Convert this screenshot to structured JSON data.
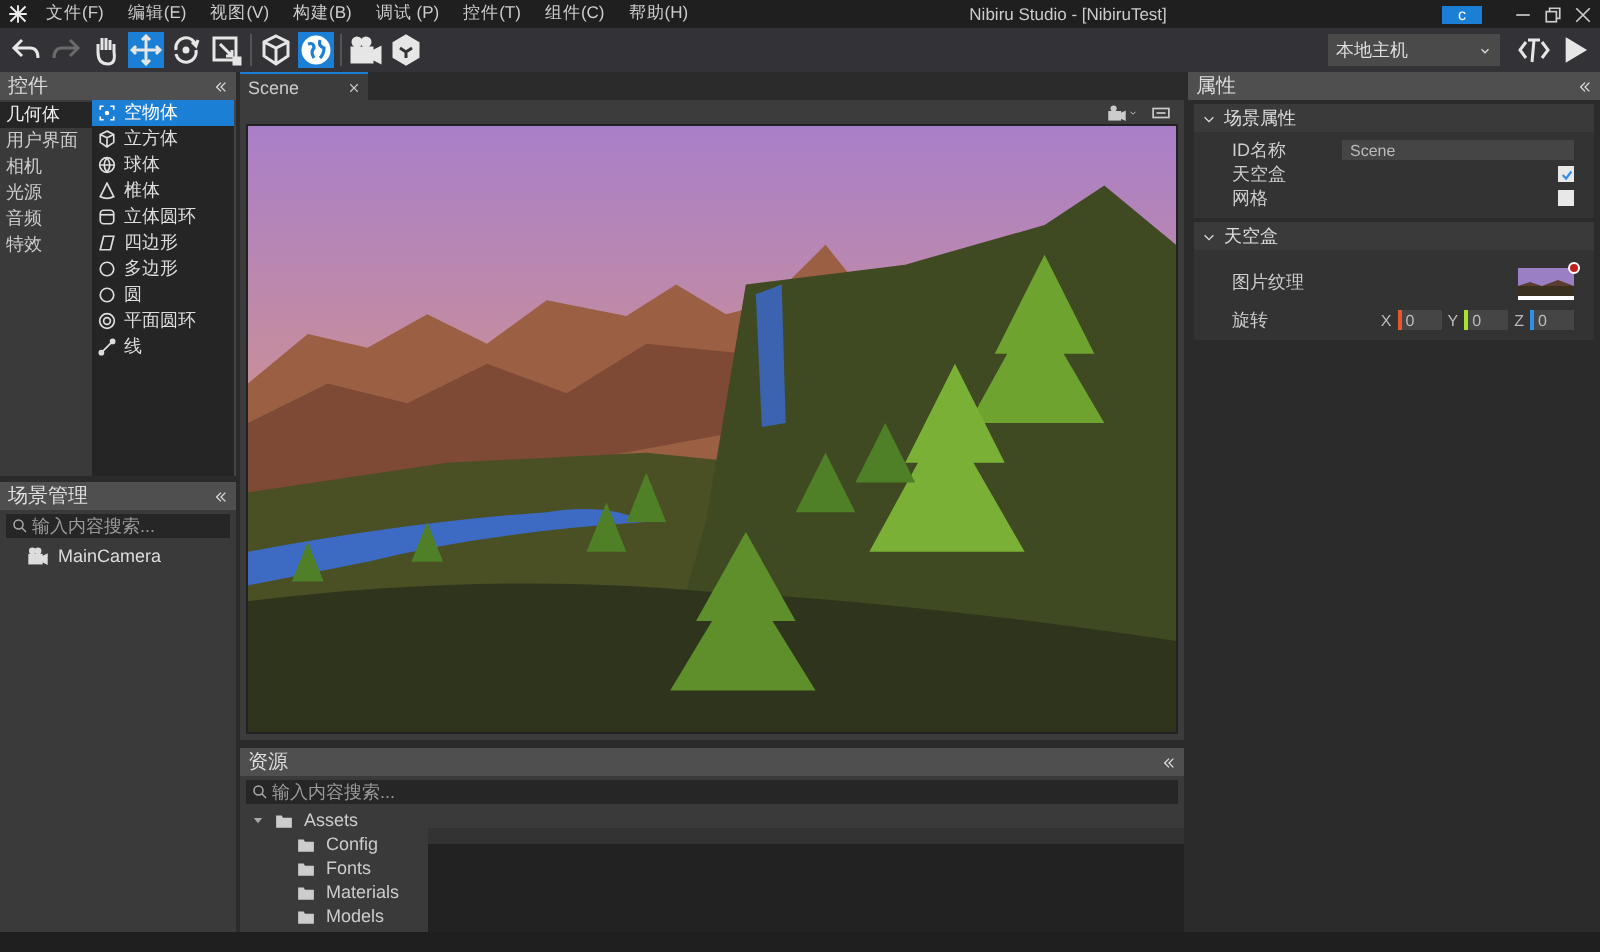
{
  "window": {
    "title": "Nibiru Studio - [NibiruTest]",
    "account_button": "c"
  },
  "menu": [
    "文件(F)",
    "编辑(E)",
    "视图(V)",
    "构建(B)",
    "调试 (P)",
    "控件(T)",
    "组件(C)",
    "帮助(H)"
  ],
  "toolbar": {
    "tools": [
      {
        "kind": "undo",
        "selected": false,
        "disabled": false
      },
      {
        "kind": "redo",
        "selected": false,
        "disabled": true
      },
      {
        "kind": "hand",
        "selected": false,
        "disabled": false
      },
      {
        "kind": "move",
        "selected": true,
        "disabled": false
      },
      {
        "kind": "rotate",
        "selected": false,
        "disabled": false
      },
      {
        "kind": "scale",
        "selected": false,
        "disabled": false
      },
      {
        "kind": "cube",
        "selected": false,
        "disabled": false
      },
      {
        "kind": "globe",
        "selected": true,
        "disabled": false
      },
      {
        "kind": "camera",
        "selected": false,
        "disabled": false
      },
      {
        "kind": "box",
        "selected": false,
        "disabled": false
      }
    ],
    "host_select": "本地主机"
  },
  "controls_panel": {
    "title": "控件",
    "categories": [
      {
        "label": "几何体",
        "selected": true
      },
      {
        "label": "用户界面",
        "selected": false
      },
      {
        "label": "相机",
        "selected": false
      },
      {
        "label": "光源",
        "selected": false
      },
      {
        "label": "音频",
        "selected": false
      },
      {
        "label": "特效",
        "selected": false
      }
    ],
    "items": [
      {
        "label": "空物体",
        "kind": "empty",
        "selected": true
      },
      {
        "label": "立方体",
        "kind": "cube",
        "selected": false
      },
      {
        "label": "球体",
        "kind": "sphere",
        "selected": false
      },
      {
        "label": "椎体",
        "kind": "cone",
        "selected": false
      },
      {
        "label": "立体圆环",
        "kind": "cylinder",
        "selected": false
      },
      {
        "label": "四边形",
        "kind": "quad",
        "selected": false
      },
      {
        "label": "多边形",
        "kind": "polygon",
        "selected": false
      },
      {
        "label": "圆",
        "kind": "circle",
        "selected": false
      },
      {
        "label": "平面圆环",
        "kind": "ring",
        "selected": false
      },
      {
        "label": "线",
        "kind": "line",
        "selected": false
      }
    ]
  },
  "scene_manager": {
    "title": "场景管理",
    "search_placeholder": "输入内容搜索...",
    "items": [
      {
        "label": "MainCamera",
        "kind": "camera"
      }
    ]
  },
  "scene_tab": {
    "label": "Scene"
  },
  "assets": {
    "title": "资源",
    "search_placeholder": "输入内容搜索...",
    "tree": [
      {
        "label": "Assets",
        "expanded": true,
        "children": [
          {
            "label": "Config"
          },
          {
            "label": "Fonts"
          },
          {
            "label": "Materials"
          },
          {
            "label": "Models"
          }
        ]
      }
    ]
  },
  "properties": {
    "title": "属性",
    "sections": [
      {
        "title": "场景属性",
        "expanded": true,
        "rows": [
          {
            "kind": "text",
            "label": "ID名称",
            "value": "Scene"
          },
          {
            "kind": "check",
            "label": "天空盒",
            "checked": true
          },
          {
            "kind": "check",
            "label": "网格",
            "checked": false
          }
        ]
      },
      {
        "title": "天空盒",
        "expanded": true,
        "rows": [
          {
            "kind": "texture",
            "label": "图片纹理"
          },
          {
            "kind": "vector",
            "label": "旋转",
            "axes": [
              {
                "label": "X",
                "value": "0",
                "color": "#e8572a"
              },
              {
                "label": "Y",
                "value": "0",
                "color": "#a6e22e"
              },
              {
                "label": "Z",
                "value": "0",
                "color": "#2f8fe8"
              }
            ]
          }
        ]
      }
    ]
  }
}
